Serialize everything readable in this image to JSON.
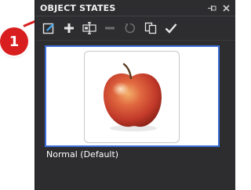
{
  "callout": {
    "number": "1"
  },
  "panel": {
    "title": "OBJECT STATES",
    "title_buttons": [
      {
        "icon": "pin-icon",
        "glyph": "⊣"
      },
      {
        "icon": "close-icon",
        "glyph": "✕"
      }
    ]
  },
  "toolbar": {
    "items": [
      {
        "name": "edit-state-button",
        "icon": "edit-state-icon",
        "enabled": true
      },
      {
        "name": "new-state-button",
        "icon": "plus-icon",
        "enabled": true
      },
      {
        "name": "rename-state-button",
        "icon": "rename-icon",
        "enabled": true
      },
      {
        "name": "delete-state-button",
        "icon": "minus-icon",
        "enabled": false
      },
      {
        "name": "reset-state-button",
        "icon": "undo-icon",
        "enabled": false
      },
      {
        "name": "duplicate-state-button",
        "icon": "duplicate-icon",
        "enabled": true
      },
      {
        "name": "done-editing-button",
        "icon": "checkmark-icon",
        "enabled": true
      }
    ]
  },
  "states": [
    {
      "label": "Normal (Default)",
      "selected": true,
      "thumbnail": "apple-image"
    }
  ],
  "colors": {
    "callout": "#d81e1e",
    "panel_bg": "#2d2d30",
    "selection_border": "#3c6fd8",
    "edit_icon_accent": "#3fa3e8"
  }
}
